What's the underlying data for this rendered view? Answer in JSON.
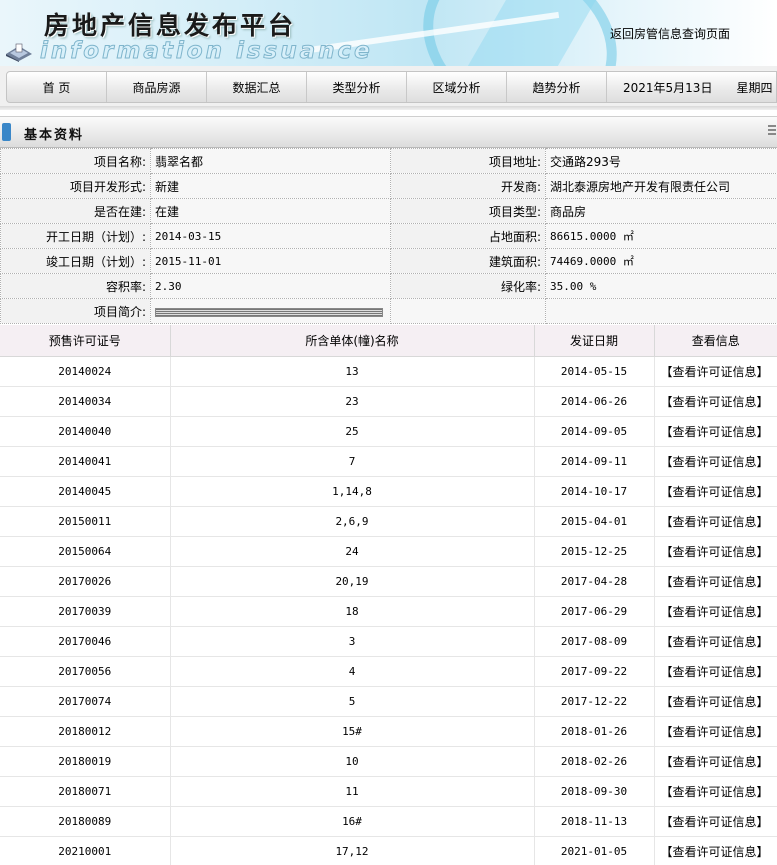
{
  "header": {
    "title": "房地产信息发布平台",
    "subtitle": "information issuance",
    "return_link": "返回房管信息查询页面"
  },
  "nav": {
    "items": [
      "首 页",
      "商品房源",
      "数据汇总",
      "类型分析",
      "区域分析",
      "趋势分析"
    ],
    "date": "2021年5月13日",
    "weekday": "星期四"
  },
  "section": {
    "title": "基本资料"
  },
  "project": {
    "name_label": "项目名称:",
    "name": "翡翠名都",
    "address_label": "项目地址:",
    "address": "交通路293号",
    "dev_form_label": "项目开发形式:",
    "dev_form": "新建",
    "developer_label": "开发商:",
    "developer": "湖北泰源房地产开发有限责任公司",
    "in_construction_label": "是否在建:",
    "in_construction": "在建",
    "type_label": "项目类型:",
    "type": "商品房",
    "start_label": "开工日期（计划）:",
    "start": "2014-03-15",
    "land_area_label": "占地面积:",
    "land_area": "86615.0000 ㎡",
    "end_label": "竣工日期（计划）:",
    "end": "2015-11-01",
    "building_area_label": "建筑面积:",
    "building_area": "74469.0000 ㎡",
    "far_label": "容积率:",
    "far": "2.30",
    "green_label": "绿化率:",
    "green": "35.00 %",
    "intro_label": "项目简介:"
  },
  "permits": {
    "headers": [
      "预售许可证号",
      "所含单体(幢)名称",
      "发证日期",
      "查看信息"
    ],
    "link_text": "【查看许可证信息】",
    "rows": [
      [
        "20140024",
        "13",
        "2014-05-15"
      ],
      [
        "20140034",
        "23",
        "2014-06-26"
      ],
      [
        "20140040",
        "25",
        "2014-09-05"
      ],
      [
        "20140041",
        "7",
        "2014-09-11"
      ],
      [
        "20140045",
        "1,14,8",
        "2014-10-17"
      ],
      [
        "20150011",
        "2,6,9",
        "2015-04-01"
      ],
      [
        "20150064",
        "24",
        "2015-12-25"
      ],
      [
        "20170026",
        "20,19",
        "2017-04-28"
      ],
      [
        "20170039",
        "18",
        "2017-06-29"
      ],
      [
        "20170046",
        "3",
        "2017-08-09"
      ],
      [
        "20170056",
        "4",
        "2017-09-22"
      ],
      [
        "20170074",
        "5",
        "2017-12-22"
      ],
      [
        "20180012",
        "15#",
        "2018-01-26"
      ],
      [
        "20180019",
        "10",
        "2018-02-26"
      ],
      [
        "20180071",
        "11",
        "2018-09-30"
      ],
      [
        "20180089",
        "16#",
        "2018-11-13"
      ],
      [
        "20210001",
        "17,12",
        "2021-01-05"
      ]
    ]
  }
}
